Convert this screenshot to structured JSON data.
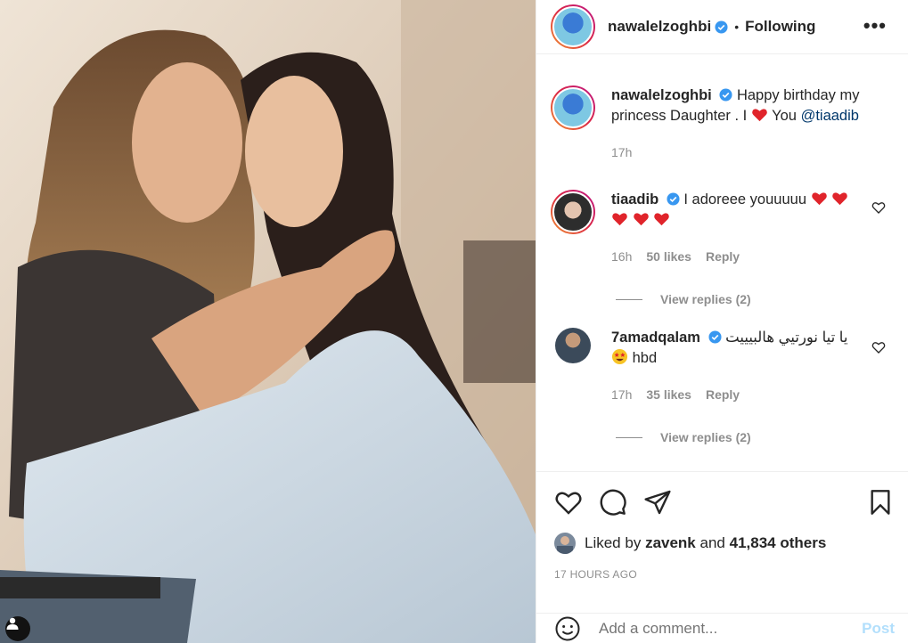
{
  "post": {
    "author": "nawalelzoghbi",
    "follow_separator": "•",
    "follow_status": "Following",
    "more_label": "•••"
  },
  "caption": {
    "author": "nawalelzoghbi",
    "text_before_heart": "Happy birthday my princess Daughter . I",
    "text_after_heart": "You",
    "mention": "@tiaadib",
    "time": "17h"
  },
  "comments": [
    {
      "user": "tiaadib",
      "text": "I adoreee youuuuu",
      "time": "16h",
      "likes": "50 likes",
      "reply": "Reply",
      "view_replies": "View replies (2)"
    },
    {
      "user": "7amadqalam",
      "text": "يا تيا نورتيي هالبيييت",
      "text2": "hbd",
      "time": "17h",
      "likes": "35 likes",
      "reply": "Reply",
      "view_replies": "View replies (2)"
    }
  ],
  "likes": {
    "prefix": "Liked by",
    "user": "zavenk",
    "conj": "and",
    "count": "41,834 others"
  },
  "timestamp": "17 HOURS AGO",
  "add_comment": {
    "placeholder": "Add a comment...",
    "post_label": "Post"
  },
  "icons": {
    "like": "heart-icon",
    "comment": "comment-icon",
    "share": "paper-plane-icon",
    "save": "bookmark-icon",
    "emoji": "smiley-icon",
    "tag": "user-tag-icon"
  },
  "colors": {
    "verified": "#3897f0",
    "heart_red": "#ed4956",
    "link": "#00376b",
    "post_disabled": "#b2dffc"
  }
}
